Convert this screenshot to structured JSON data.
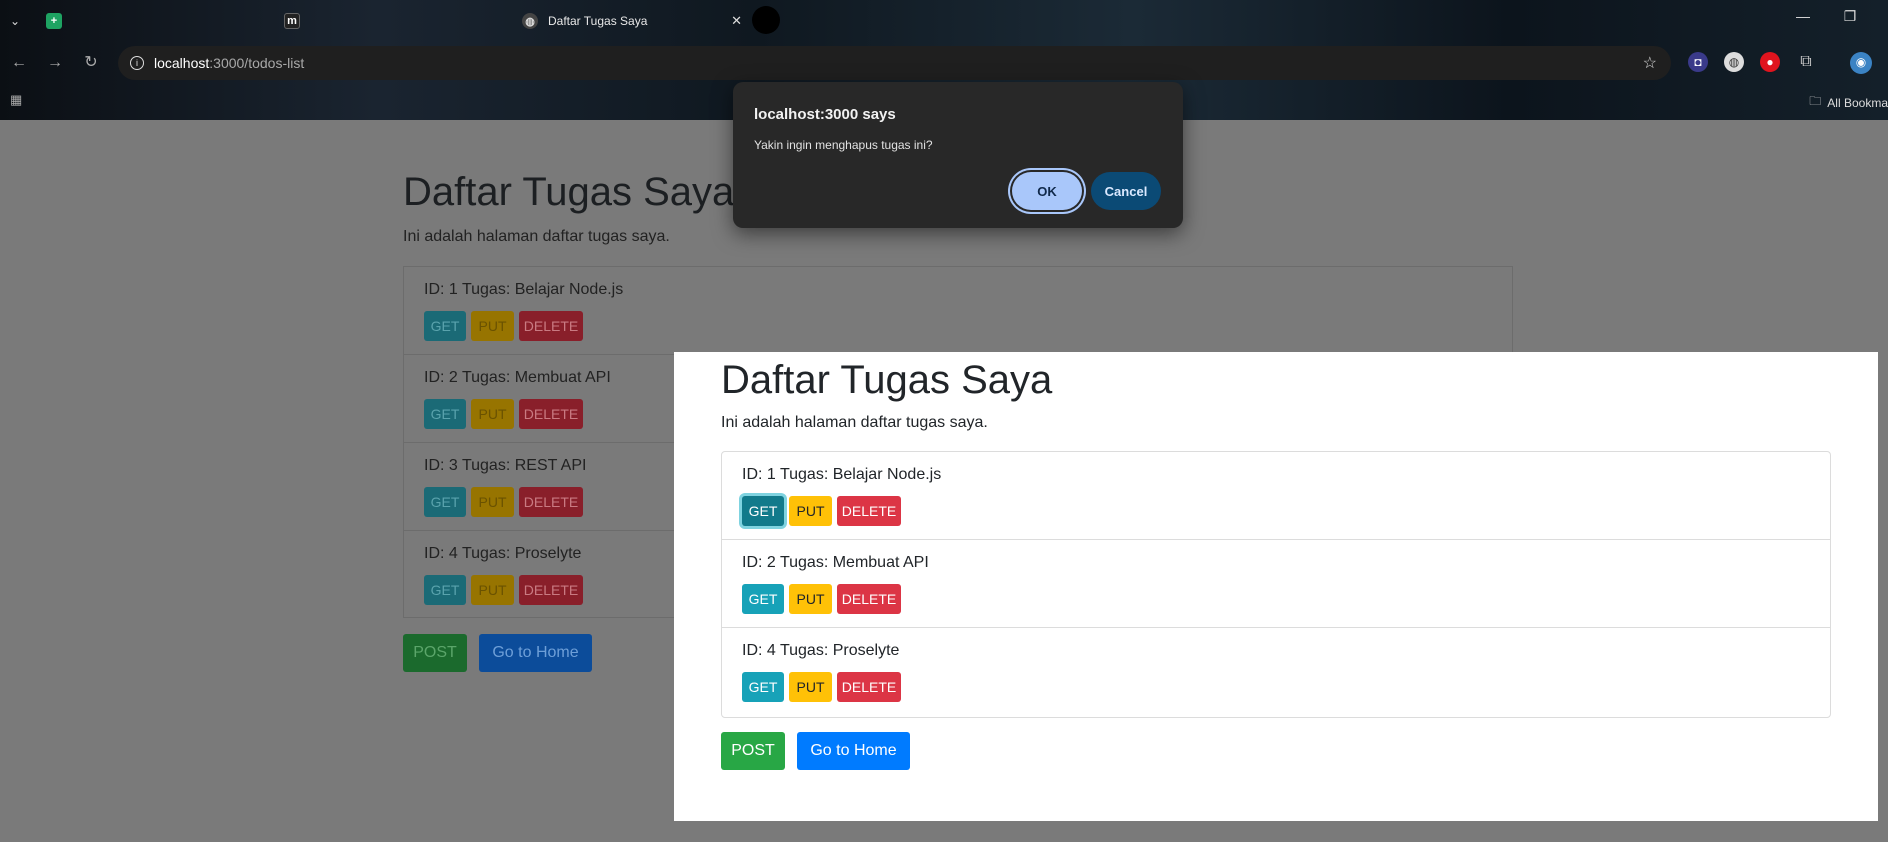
{
  "browser": {
    "tabs": [
      {
        "label": "",
        "icon": "sheets-icon"
      },
      {
        "label": "",
        "icon": "fm-icon"
      },
      {
        "label": "Daftar Tugas Saya",
        "icon": "globe-icon"
      }
    ],
    "url_host": "localhost",
    "url_rest": ":3000/todos-list",
    "bookmarks_label": "All Bookma"
  },
  "background_page": {
    "title": "Daftar Tugas Saya",
    "subtitle": "Ini adalah halaman daftar tugas saya.",
    "items": [
      {
        "text": "ID: 1 Tugas: Belajar Node.js"
      },
      {
        "text": "ID: 2 Tugas: Membuat API"
      },
      {
        "text": "ID: 3 Tugas: REST API"
      },
      {
        "text": "ID: 4 Tugas: Proselyte"
      }
    ],
    "get_label": "GET",
    "put_label": "PUT",
    "delete_label": "DELETE",
    "post_label": "POST",
    "home_label": "Go to Home"
  },
  "foreground_page": {
    "title": "Daftar Tugas Saya",
    "subtitle": "Ini adalah halaman daftar tugas saya.",
    "items": [
      {
        "text": "ID: 1 Tugas: Belajar Node.js"
      },
      {
        "text": "ID: 2 Tugas: Membuat API"
      },
      {
        "text": "ID: 4 Tugas: Proselyte"
      }
    ],
    "get_label": "GET",
    "put_label": "PUT",
    "delete_label": "DELETE",
    "post_label": "POST",
    "home_label": "Go to Home"
  },
  "dialog": {
    "title": "localhost:3000 says",
    "message": "Yakin ingin menghapus tugas ini?",
    "ok_label": "OK",
    "cancel_label": "Cancel"
  },
  "colors": {
    "get": "#17a2b8",
    "put": "#ffc107",
    "delete": "#dc3545",
    "post": "#28a745",
    "home": "#007bff"
  }
}
